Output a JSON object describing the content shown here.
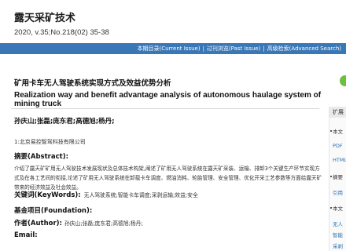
{
  "journal": {
    "title": "露天采矿技术",
    "citation": "2020, v.35;No.218(02) 35-38"
  },
  "navbar": {
    "current_issue": "本期目录(Current Issue)",
    "past_issue": "过刊浏览(Past Issue)",
    "advanced_search": "高级检索(Advanced Search)",
    "separator": "|",
    "bg_color": "#3a77b6"
  },
  "article": {
    "title_cn": "矿用卡车无人驾驶系统实现方式及效益优势分析",
    "title_en": "Realization way and benefit advantage analysis of autonomous haulage system of mining truck",
    "authors": "孙庆山;张磊;庞东君;高德旭;杨丹;",
    "affiliation": "1:北京易控智驾科技有限公司",
    "abstract_label": "摘要(Abstract):",
    "abstract_text": "介绍了露天矿矿用无人驾驶技术发展现状及总体技术构架,阐述了矿用无人驾驶系统在露天矿采装、运输、排卸3个关键生产环节实现方式及在各工艺间的衔接,论述了矿用无人驾驶系统在卸载卡车调度、燃油消耗、轮胎管理、安全管理、优化开采工艺参数等方面给露天矿带来的经济效益及社会效益。",
    "keywords_label": "关键词(KeyWords):",
    "keywords_value": "无人驾驶系统;智能卡车调度;采剥运输;效益;安全",
    "fund_label": "基金项目(Foundation):",
    "author_label": "作者(Author):",
    "author_value": "孙庆山;张磊;庞东君;高德旭;杨丹;",
    "email_label": "Email:"
  },
  "sidebar": {
    "tab": "扩展",
    "items": [
      "本文",
      "PDF",
      "HTML",
      "摘要",
      "引用",
      "本文",
      "无人",
      "智能",
      "采剥",
      "效益"
    ]
  }
}
